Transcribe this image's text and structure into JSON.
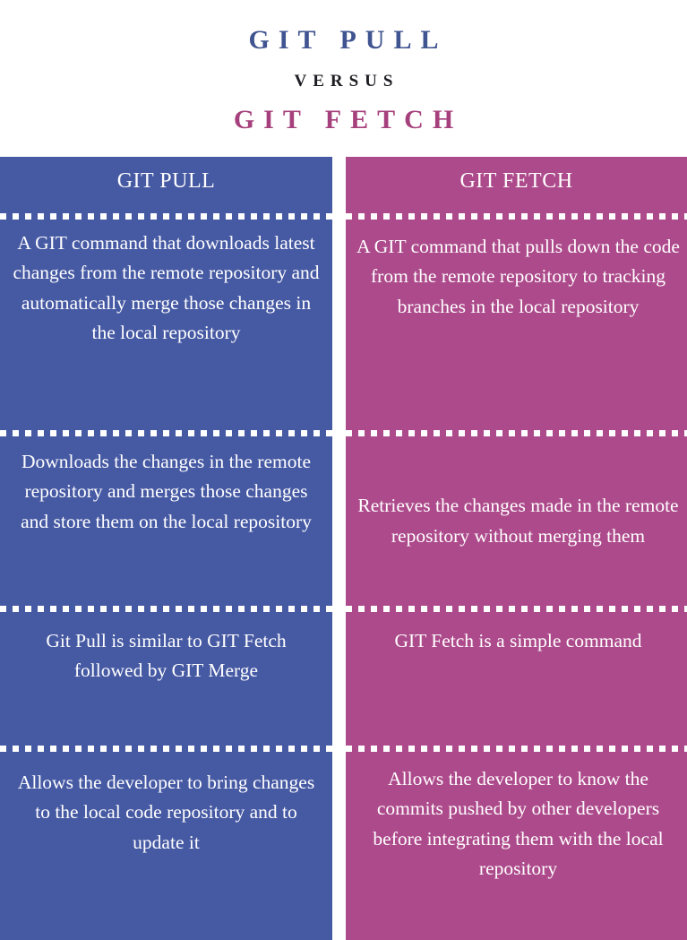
{
  "header": {
    "title_main": "GIT PULL",
    "title_versus": "VERSUS",
    "title_sub": "GIT FETCH",
    "color_main": "#3f5490",
    "color_versus": "#1c1c22",
    "color_sub": "#a6407c"
  },
  "columns": [
    {
      "key": "git_pull",
      "heading": "GIT PULL",
      "background": "#4659a3",
      "text_color": "#ffffff",
      "rows": [
        "A GIT command that downloads latest changes from the remote repository and automatically merge those changes in the local repository",
        "Downloads the changes in the remote repository and merges those changes and store them on the local repository",
        "Git Pull is similar to GIT Fetch followed by GIT Merge",
        "Allows the developer to bring changes to the local code repository and to update it"
      ]
    },
    {
      "key": "git_fetch",
      "heading": "GIT FETCH",
      "background": "#ad4a8b",
      "text_color": "#ffffff",
      "rows": [
        "A GIT command that pulls down the code from the remote repository to tracking branches in the local repository",
        "Retrieves the changes made in the remote repository without merging them",
        "GIT Fetch is a simple command",
        "Allows the developer to know the commits pushed by other developers before integrating them with the local repository"
      ]
    }
  ]
}
